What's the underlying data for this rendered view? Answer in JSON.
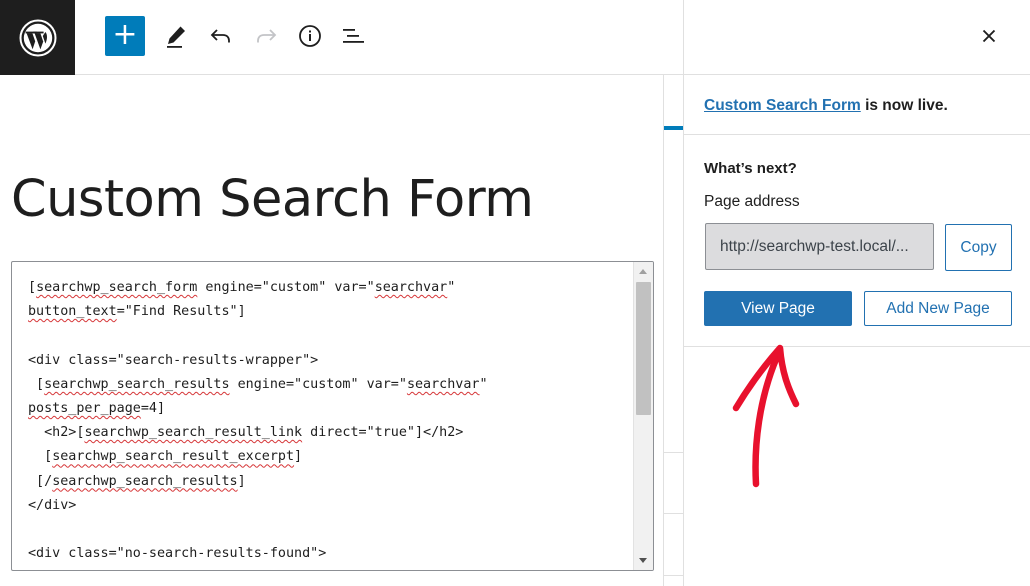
{
  "toolbar": {
    "logo": "wordpress-logo",
    "add_block": "+",
    "tools_icon": "pencil-icon",
    "undo_icon": "undo-icon",
    "redo_icon": "redo-icon",
    "details_icon": "info-icon",
    "list_view_icon": "list-view-icon"
  },
  "editor": {
    "post_title": "Custom Search Form",
    "code_lines": [
      [
        {
          "t": "[",
          "w": false
        },
        {
          "t": "searchwp_search_form",
          "w": true
        },
        {
          "t": " engine=\"custom\" var=\"",
          "w": false
        },
        {
          "t": "searchvar",
          "w": true
        },
        {
          "t": "\"",
          "w": false
        }
      ],
      [
        {
          "t": "button_text",
          "w": true
        },
        {
          "t": "=\"Find Results\"]",
          "w": false
        }
      ],
      [],
      [
        {
          "t": "<div class=\"search-results-wrapper\">",
          "w": false
        }
      ],
      [
        {
          "t": " [",
          "w": false
        },
        {
          "t": "searchwp_search_results",
          "w": true
        },
        {
          "t": " engine=\"custom\" var=\"",
          "w": false
        },
        {
          "t": "searchvar",
          "w": true
        },
        {
          "t": "\"",
          "w": false
        }
      ],
      [
        {
          "t": "posts_per_page",
          "w": true
        },
        {
          "t": "=4]",
          "w": false
        }
      ],
      [
        {
          "t": "  <h2>[",
          "w": false
        },
        {
          "t": "searchwp_search_result_link",
          "w": true
        },
        {
          "t": " direct=\"true\"]</h2>",
          "w": false
        }
      ],
      [
        {
          "t": "  [",
          "w": false
        },
        {
          "t": "searchwp_search_result_excerpt",
          "w": true
        },
        {
          "t": "]",
          "w": false
        }
      ],
      [
        {
          "t": " [/",
          "w": false
        },
        {
          "t": "searchwp_search_results",
          "w": true
        },
        {
          "t": "]",
          "w": false
        }
      ],
      [
        {
          "t": "</div>",
          "w": false
        }
      ],
      [],
      [
        {
          "t": "<div class=\"no-search-results-found\">",
          "w": false
        }
      ]
    ]
  },
  "post_publish": {
    "close_icon": "close-icon",
    "post_link_text": "Custom Search Form",
    "live_suffix": " is now live.",
    "whats_next": "What’s next?",
    "page_address_label": "Page address",
    "page_address_value": "http://searchwp-test.local/...",
    "copy_label": "Copy",
    "view_page_label": "View Page",
    "add_new_page_label": "Add New Page"
  },
  "annotation": {
    "arrow_color": "#e8112d",
    "arrow_icon": "hand-drawn-arrow-up-icon"
  },
  "colors": {
    "accent": "#2271b1",
    "toolbar_add": "#007cba",
    "logo_bg": "#1e1e1e"
  }
}
